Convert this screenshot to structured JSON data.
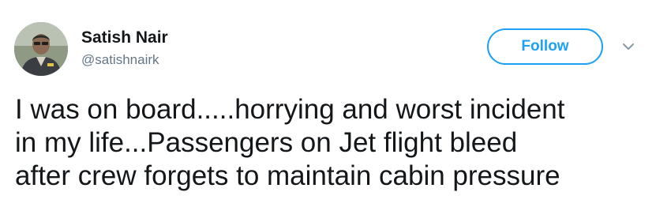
{
  "author": {
    "name": "Satish Nair",
    "handle": "@satishnairk"
  },
  "follow_button": {
    "label": "Follow"
  },
  "menu": {
    "icon": "chevron-down-icon"
  },
  "tweet": {
    "lines": [
      "I was on board.....horrying and worst incident",
      "in my life...Passengers on Jet flight bleed",
      "after crew forgets to maintain cabin pressure"
    ]
  },
  "colors": {
    "accent": "#1da1f2",
    "text": "#14171a",
    "secondary": "#657786"
  }
}
